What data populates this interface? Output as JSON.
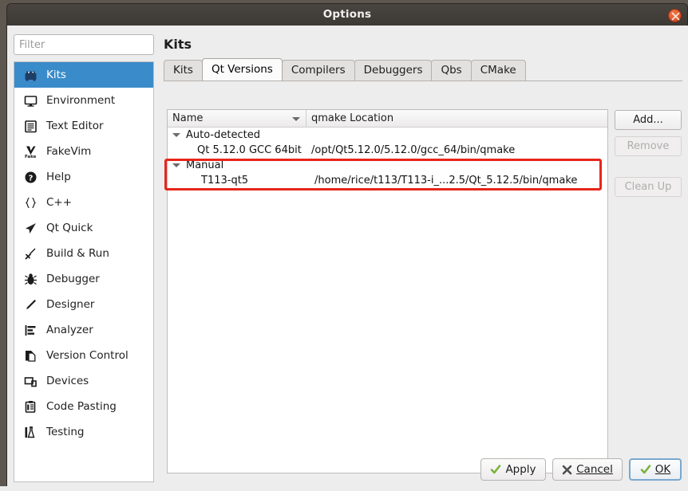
{
  "window": {
    "title": "Options",
    "close_icon": "close-icon"
  },
  "sidebar": {
    "filter_placeholder": "Filter",
    "filter_value": "",
    "items": [
      {
        "label": "Kits",
        "icon": "kits-icon",
        "selected": true
      },
      {
        "label": "Environment",
        "icon": "monitor-icon",
        "selected": false
      },
      {
        "label": "Text Editor",
        "icon": "text-editor-icon",
        "selected": false
      },
      {
        "label": "FakeVim",
        "icon": "fakevim-icon",
        "selected": false
      },
      {
        "label": "Help",
        "icon": "help-icon",
        "selected": false
      },
      {
        "label": "C++",
        "icon": "braces-icon",
        "selected": false
      },
      {
        "label": "Qt Quick",
        "icon": "paper-plane-icon",
        "selected": false
      },
      {
        "label": "Build & Run",
        "icon": "hammer-icon",
        "selected": false
      },
      {
        "label": "Debugger",
        "icon": "bug-icon",
        "selected": false
      },
      {
        "label": "Designer",
        "icon": "pencil-icon",
        "selected": false
      },
      {
        "label": "Analyzer",
        "icon": "analyzer-icon",
        "selected": false
      },
      {
        "label": "Version Control",
        "icon": "version-control-icon",
        "selected": false
      },
      {
        "label": "Devices",
        "icon": "devices-icon",
        "selected": false
      },
      {
        "label": "Code Pasting",
        "icon": "clipboard-icon",
        "selected": false
      },
      {
        "label": "Testing",
        "icon": "testing-icon",
        "selected": false
      }
    ]
  },
  "main": {
    "page_title": "Kits",
    "tabs": [
      {
        "label": "Kits",
        "active": false
      },
      {
        "label": "Qt Versions",
        "active": true
      },
      {
        "label": "Compilers",
        "active": false
      },
      {
        "label": "Debuggers",
        "active": false
      },
      {
        "label": "Qbs",
        "active": false
      },
      {
        "label": "CMake",
        "active": false
      }
    ],
    "table": {
      "columns": [
        "Name",
        "qmake Location"
      ],
      "sorted_column": "Name",
      "rows": [
        {
          "type": "group",
          "name": "Auto-detected",
          "location": "",
          "expanded": true
        },
        {
          "type": "child",
          "name": "Qt 5.12.0 GCC 64bit",
          "location": "/opt/Qt5.12.0/5.12.0/gcc_64/bin/qmake"
        },
        {
          "type": "group",
          "name": "Manual",
          "location": "",
          "expanded": true
        },
        {
          "type": "child",
          "name": "T113-qt5",
          "location": "/home/rice/t113/T113-i_...2.5/Qt_5.12.5/bin/qmake"
        }
      ]
    },
    "side_buttons": [
      {
        "label": "Add...",
        "enabled": true
      },
      {
        "label": "Remove",
        "enabled": false
      },
      {
        "label": "Clean Up",
        "enabled": false
      }
    ],
    "annotation": {
      "color": "#e8251b",
      "target": "Manual / T113-qt5 row group"
    }
  },
  "footer": {
    "buttons": [
      {
        "label": "Apply",
        "icon": "check-icon",
        "mnemonic": "",
        "default": false
      },
      {
        "label": "Cancel",
        "icon": "cross-icon",
        "mnemonic": "C",
        "default": false
      },
      {
        "label": "OK",
        "icon": "check-icon",
        "mnemonic": "O",
        "default": true
      }
    ]
  },
  "colors": {
    "selection": "#3a8bc9",
    "annotation": "#e8251b",
    "titlebar": "#413c37",
    "close_button": "#e0562a"
  }
}
